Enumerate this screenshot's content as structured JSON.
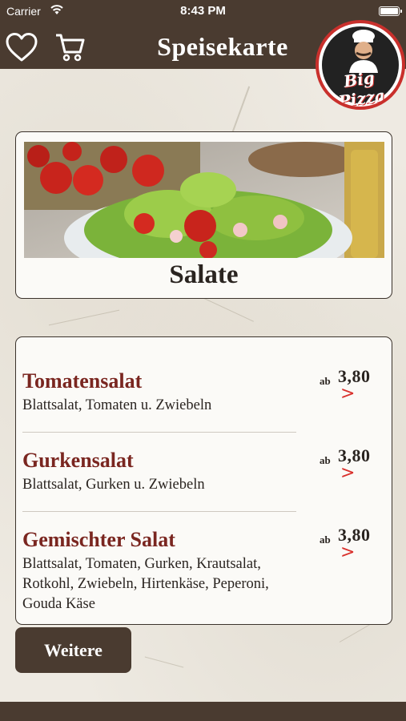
{
  "status_bar": {
    "carrier": "Carrier",
    "time": "8:43 PM"
  },
  "nav": {
    "title": "Speisekarte",
    "favorites_icon": "heart-outline-icon",
    "cart_icon": "shopping-cart-icon",
    "logo_text": "Big Pizza"
  },
  "category": {
    "title": "Salate"
  },
  "menu": {
    "items": [
      {
        "name": "Tomatensalat",
        "description": "Blattsalat, Tomaten u. Zwiebeln",
        "prefix": "ab",
        "price": "3,80",
        "arrow": ">"
      },
      {
        "name": "Gurkensalat",
        "description": "Blattsalat, Gurken u. Zwiebeln",
        "prefix": "ab",
        "price": "3,80",
        "arrow": ">"
      },
      {
        "name": "Gemischter Salat",
        "description": "Blattsalat, Tomaten, Gurken, Krautsalat, Rotkohl, Zwiebeln, Hirtenkäse, Peperoni, Gouda Käse",
        "prefix": "ab",
        "price": "3,80",
        "arrow": ">"
      }
    ]
  },
  "more_button": {
    "label": "Weitere"
  },
  "colors": {
    "bar": "#4a3b30",
    "item_name": "#7a2620",
    "arrow": "#d9302c",
    "background": "#eeeae2"
  }
}
